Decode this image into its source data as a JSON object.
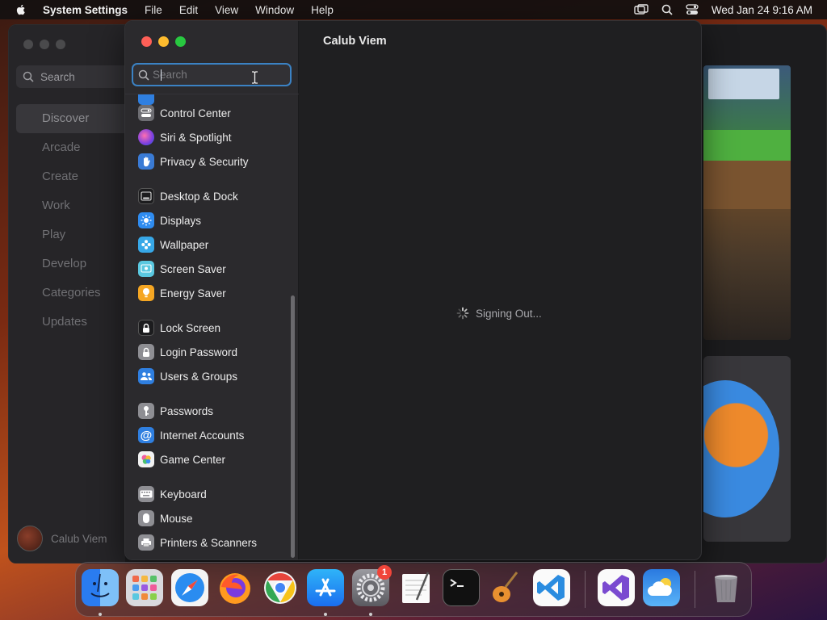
{
  "menubar": {
    "app_name": "System Settings",
    "menus": [
      "File",
      "Edit",
      "View",
      "Window",
      "Help"
    ],
    "datetime": "Wed Jan 24  9:16 AM"
  },
  "background_app": {
    "search_placeholder": "Search",
    "nav": [
      "Discover",
      "Arcade",
      "Create",
      "Work",
      "Play",
      "Develop",
      "Categories",
      "Updates"
    ],
    "active_nav": "Discover",
    "user_name": "Calub Viem"
  },
  "settings": {
    "search_placeholder": "Search",
    "sidebar": [
      {
        "label": "Control Center",
        "icon": "control-center-icon",
        "color": "#6e6e73"
      },
      {
        "label": "Siri & Spotlight",
        "icon": "siri-icon",
        "color": "#b04ed8"
      },
      {
        "label": "Privacy & Security",
        "icon": "hand-icon",
        "color": "#3a7bd5"
      },
      {
        "label": "Desktop & Dock",
        "icon": "dock-icon",
        "color": "#1c1c1e"
      },
      {
        "label": "Displays",
        "icon": "sun-icon",
        "color": "#2f8cf0"
      },
      {
        "label": "Wallpaper",
        "icon": "flower-icon",
        "color": "#37a8e8"
      },
      {
        "label": "Screen Saver",
        "icon": "screen-saver-icon",
        "color": "#5ac8e0"
      },
      {
        "label": "Energy Saver",
        "icon": "bulb-icon",
        "color": "#f5a623"
      },
      {
        "label": "Lock Screen",
        "icon": "lock-icon",
        "color": "#1c1c1e"
      },
      {
        "label": "Login Password",
        "icon": "lock-icon",
        "color": "#8e8e93"
      },
      {
        "label": "Users & Groups",
        "icon": "users-icon",
        "color": "#2f7fe0"
      },
      {
        "label": "Passwords",
        "icon": "key-icon",
        "color": "#8e8e93"
      },
      {
        "label": "Internet Accounts",
        "icon": "at-icon",
        "color": "#2f7fe0"
      },
      {
        "label": "Game Center",
        "icon": "game-center-icon",
        "color": "#e8e8e8"
      },
      {
        "label": "Keyboard",
        "icon": "keyboard-icon",
        "color": "#8e8e93"
      },
      {
        "label": "Mouse",
        "icon": "mouse-icon",
        "color": "#8e8e93"
      },
      {
        "label": "Printers & Scanners",
        "icon": "printer-icon",
        "color": "#8e8e93"
      }
    ],
    "content_title": "Calub Viem",
    "status_text": "Signing Out..."
  },
  "dock": {
    "apps": [
      {
        "name": "Finder",
        "icon": "finder-icon",
        "running": true
      },
      {
        "name": "Launchpad",
        "icon": "launchpad-icon",
        "running": false
      },
      {
        "name": "Safari",
        "icon": "safari-icon",
        "running": false
      },
      {
        "name": "Firefox",
        "icon": "firefox-icon",
        "running": false
      },
      {
        "name": "Chrome",
        "icon": "chrome-icon",
        "running": false
      },
      {
        "name": "App Store",
        "icon": "app-store-icon",
        "running": true
      },
      {
        "name": "System Settings",
        "icon": "gear-icon",
        "running": true
      },
      {
        "name": "TextEdit",
        "icon": "textedit-icon",
        "running": false
      },
      {
        "name": "Terminal",
        "icon": "terminal-icon",
        "running": false
      },
      {
        "name": "GarageBand",
        "icon": "guitar-icon",
        "running": false
      },
      {
        "name": "Visual Studio Code",
        "icon": "vscode-icon",
        "running": false
      },
      {
        "name": "Visual Studio",
        "icon": "visual-studio-icon",
        "running": false
      },
      {
        "name": "Weather",
        "icon": "cloud-icon",
        "running": false
      },
      {
        "name": "Trash",
        "icon": "trash-icon",
        "running": false
      }
    ],
    "settings_badge": "1"
  }
}
